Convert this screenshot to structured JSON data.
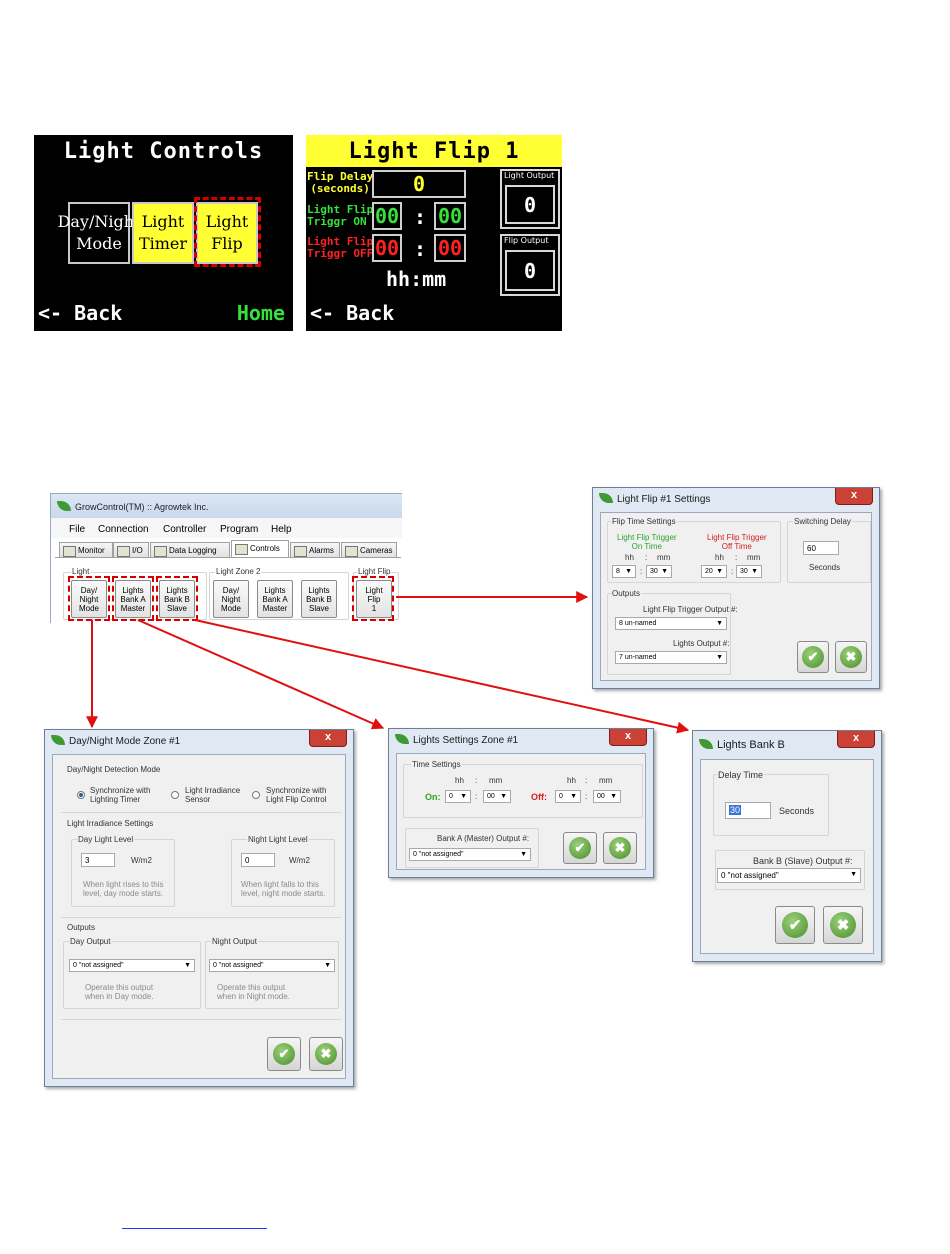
{
  "light_controls_screen": {
    "title": "Light Controls",
    "buttons": [
      {
        "label": "Day/Night\nMode"
      },
      {
        "label": "Light\nTimer"
      },
      {
        "label": "Light\nFlip"
      }
    ],
    "back": "<- Back",
    "home": "Home"
  },
  "light_flip_screen": {
    "title": "Light Flip 1",
    "flip_delay_label": "Flip Delay\n(seconds)",
    "flip_delay_value": "0",
    "trigger_on_label": "Light Flip\nTriggr ON",
    "trigger_on_hh": "00",
    "trigger_on_mm": "00",
    "trigger_off_label": "Light Flip\nTriggr OFF",
    "trigger_off_hh": "00",
    "trigger_off_mm": "00",
    "colon": ":",
    "hhmm": "hh:mm",
    "light_output_label": "Light Output",
    "light_output_value": "0",
    "flip_output_label": "Flip Output",
    "flip_output_value": "0",
    "back": "<- Back"
  },
  "main_window": {
    "title": "GrowControl(TM) :: Agrowtek Inc.",
    "menu": [
      "File",
      "Connection",
      "Controller",
      "Program",
      "Help"
    ],
    "tabs": [
      "Monitor",
      "I/O",
      "Data Logging",
      "Controls",
      "Alarms",
      "Cameras"
    ],
    "group_light": "Light",
    "group_zone2": "Light Zone 2",
    "group_flip": "Light Flip",
    "buttons_light": [
      "Day/\nNight\nMode",
      "Lights\nBank A\nMaster",
      "Lights\nBank B\nSlave"
    ],
    "buttons_zone2": [
      "Day/\nNight\nMode",
      "Lights\nBank A\nMaster",
      "Lights\nBank B\nSlave"
    ],
    "button_flip": "Light\nFlip\n1"
  },
  "flip_settings_dialog": {
    "title": "Light Flip #1 Settings",
    "close": "x",
    "flip_time_settings": "Flip Time Settings",
    "on_time_label": "Light Flip Trigger\nOn Time",
    "off_time_label": "Light Flip Trigger\nOff Time",
    "hh": "hh",
    "mm": "mm",
    "colon": ":",
    "on_hh": "8",
    "on_mm": "30",
    "off_hh": "20",
    "off_mm": "30",
    "switching_delay": "Switching Delay",
    "delay_value": "60",
    "seconds": "Seconds",
    "outputs": "Outputs",
    "trigger_output_label": "Light Flip Trigger Output #:",
    "trigger_output_value": "8 un-named",
    "lights_output_label": "Lights Output #:",
    "lights_output_value": "7 un-named",
    "colors": {
      "on": "#2aa52a",
      "off": "#d42020"
    }
  },
  "daynight_dialog": {
    "title": "Day/Night Mode Zone #1",
    "close": "x",
    "detection_mode": "Day/Night Detection Mode",
    "radio_1": "Synchronize with\nLighting Timer",
    "radio_2": "Light Irradiance\nSensor",
    "radio_3": "Synchronize with\nLight Flip Control",
    "irradiance_settings": "Light Irradiance Settings",
    "day_level": "Day Light Level",
    "day_value": "3",
    "night_level": "Night Light Level",
    "night_value": "0",
    "unit": "W/m2",
    "day_help": "When light rises to this\nlevel, day mode starts.",
    "night_help": "When light falls to this\nlevel, night mode starts.",
    "outputs": "Outputs",
    "day_output": "Day Output",
    "night_output": "Night Output",
    "day_output_value": "0 \"not assigned\"",
    "night_output_value": "0 \"not assigned\"",
    "day_output_help": "Operate this output\nwhen in Day mode.",
    "night_output_help": "Operate this output\nwhen in Night mode."
  },
  "lights_zone_dialog": {
    "title": "Lights Settings Zone #1",
    "close": "x",
    "time_settings": "Time Settings",
    "hh": "hh",
    "mm": "mm",
    "colon": ":",
    "on_label": "On:",
    "on_hh": "0",
    "on_mm": "00",
    "off_label": "Off:",
    "off_hh": "0",
    "off_mm": "00",
    "bank_a_output_label": "Bank A (Master) Output #:",
    "bank_a_output_value": "0 \"not assigned\""
  },
  "bank_b_dialog": {
    "title": "Lights Bank B",
    "close": "x",
    "delay_time": "Delay Time",
    "delay_value": "30",
    "seconds": "Seconds",
    "bank_b_output_label": "Bank B (Slave) Output #:",
    "bank_b_output_value": "0 \"not assigned\""
  },
  "icons": [
    "leaf-icon",
    "checkmark-icon",
    "cancel-icon",
    "dropdown-arrow-icon"
  ]
}
